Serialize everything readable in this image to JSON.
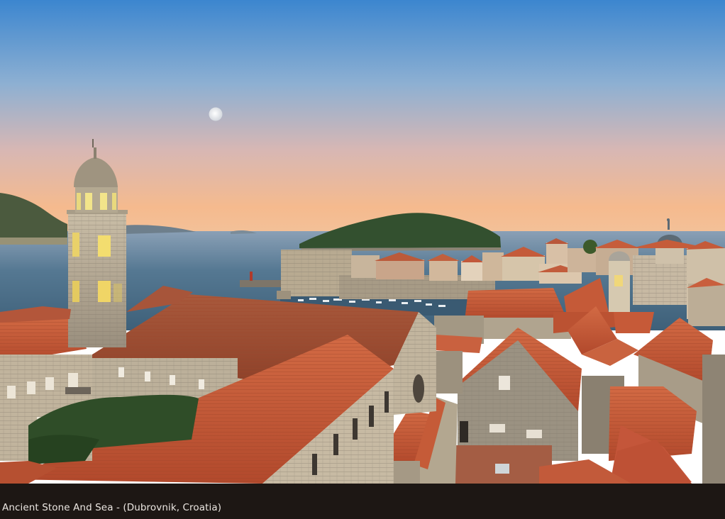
{
  "photo": {
    "subject": "Dubrovnik old town rooftops, bell tower, harbour and Lokrum island at dusk with moon",
    "colors": {
      "sky_top": "#3d86cf",
      "sky_mid": "#b7b6c7",
      "sky_horizon": "#f3b98f",
      "sea": "#4a6e8c",
      "roof": "#c55a38",
      "stone": "#b6a993",
      "island": "#33502f"
    }
  },
  "caption": {
    "text": "Ancient Stone And Sea - (Dubrovnik, Croatia)",
    "background": "#1d1714",
    "color": "#ece7e2"
  }
}
